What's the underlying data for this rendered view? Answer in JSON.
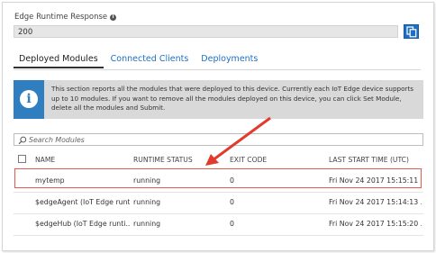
{
  "response": {
    "label": "Edge Runtime Response",
    "value": "200"
  },
  "tabs": [
    {
      "label": "Deployed Modules",
      "active": true
    },
    {
      "label": "Connected Clients",
      "active": false
    },
    {
      "label": "Deployments",
      "active": false
    }
  ],
  "notice": {
    "text": "This section reports all the modules that were deployed to this device. Currently each IoT Edge device supports up to 10 modules. If you want to remove all the modules deployed on this device, you can click Set Module, delete all the modules and Submit."
  },
  "search": {
    "placeholder": "Search Modules"
  },
  "table": {
    "headers": {
      "name": "NAME",
      "status": "RUNTIME STATUS",
      "exit": "EXIT CODE",
      "start": "LAST START TIME (UTC)"
    },
    "rows": [
      {
        "name": "mytemp",
        "status": "running",
        "exit": "0",
        "start": "Fri Nov 24 2017 15:15:11 ..."
      },
      {
        "name": "$edgeAgent (IoT Edge runti...",
        "status": "running",
        "exit": "0",
        "start": "Fri Nov 24 2017 15:14:13 ..."
      },
      {
        "name": "$edgeHub (IoT Edge runti...",
        "status": "running",
        "exit": "0",
        "start": "Fri Nov 24 2017 15:15:20 ..."
      }
    ]
  },
  "colors": {
    "accent": "#1e6fc4",
    "info_block": "#2f7ec0",
    "highlight": "#e85a50"
  },
  "icons": [
    "info-icon",
    "copy-icon",
    "search-icon",
    "arrow-annotation"
  ]
}
